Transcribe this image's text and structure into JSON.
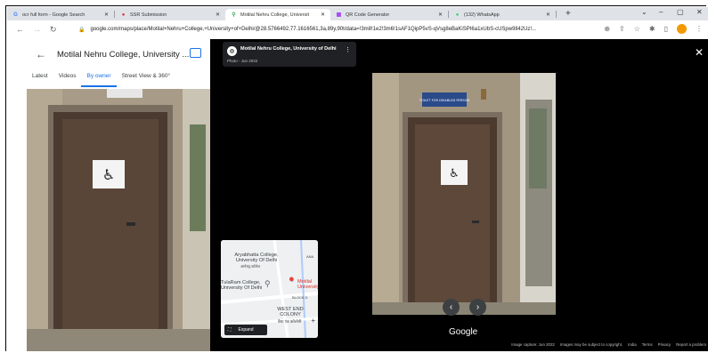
{
  "browser": {
    "tabs": [
      {
        "favicon": "G",
        "favicon_color": "#4285f4",
        "label": "ocr full form - Google Search",
        "active": false
      },
      {
        "favicon": "●",
        "favicon_color": "#d93025",
        "label": "SSR Submission",
        "active": false
      },
      {
        "favicon": "⚲",
        "favicon_color": "#34a853",
        "label": "Motilal Nehru College, Universit",
        "active": true
      },
      {
        "favicon": "▦",
        "favicon_color": "#a142f4",
        "label": "QR Code Generator",
        "active": false
      },
      {
        "favicon": "●",
        "favicon_color": "#25d366",
        "label": "(132) WhatsApp",
        "active": false
      }
    ],
    "new_tab": "+",
    "window_controls": {
      "dropdown": "⌄",
      "minimize": "–",
      "restore": "▢",
      "close": "✕"
    },
    "url": "google.com/maps/place/Motilal+Nehru+College,+University+of+Delhi/@28.5766492,77.1616561,3a,89y,90t/data=!3m8!1e2!3m6!1sAF1QipP5vS-qVsg8eBaKiSPI6a1xUbS-cUSpw9Il42Uz!..."
  },
  "left_panel": {
    "title": "Motilal Nehru College, University ...",
    "tabs": [
      "Latest",
      "Videos",
      "By owner",
      "Street View & 360°"
    ],
    "selected_tab": "By owner"
  },
  "viewer": {
    "place_name": "Motilal Nehru College, University of Delhi",
    "photo_date": "Photo - Jun 2022",
    "sign_text": "TOILET FOR DISABLED PERSON",
    "google_label": "Google",
    "footer": [
      "Image capture: Jun 2022",
      "Images may be subject to copyright.",
      "India",
      "Terms",
      "Privacy",
      "Report a problem"
    ]
  },
  "minimap": {
    "labels": {
      "aryabhatta": "Aryabhatta College, University Of Delhi",
      "aryabhatta_hi": "आर्यभट्ट कॉलेज",
      "ram_lal": "TulaRam College, University Of Delhi",
      "motilal": "Motilal University",
      "west_end": "WEST END COLONY",
      "west_end_hi": "वैस्ट एंड कॉलोनी",
      "block_d": "BLOCK D",
      "ana": "ANA"
    },
    "expand_label": "Expand"
  }
}
